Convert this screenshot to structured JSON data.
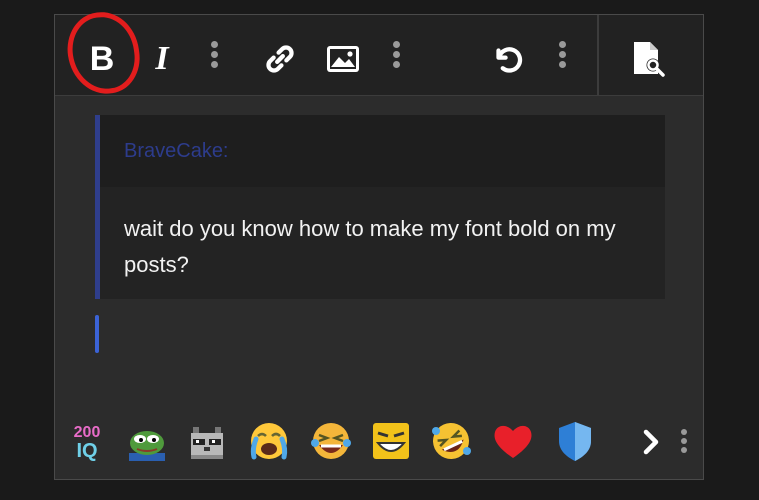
{
  "toolbar": {
    "bold_label": "B",
    "italic_label": "I",
    "buttons": [
      "bold",
      "italic",
      "more-options",
      "link",
      "image",
      "more-options",
      "undo",
      "more-options",
      "preview"
    ]
  },
  "annotation": {
    "color": "#e31d1d",
    "shape": "circle",
    "target": "bold"
  },
  "quote": {
    "author": "BraveCake:",
    "text": "wait do you know how to make my font bold on my posts?"
  },
  "emoji_bar": {
    "items": [
      "200iq-icon",
      "pepe-frog-icon",
      "raccoon-pixel-icon",
      "crying-emoji-icon",
      "laughing-crying-emoji-icon",
      "laughing-square-emoji-icon",
      "rolling-laughing-emoji-icon",
      "red-heart-icon",
      "blue-shield-icon"
    ]
  },
  "colors": {
    "background": "#1a1a1a",
    "editor": "#2c2c2c",
    "toolbar": "#222222",
    "quote_accent": "#2f3e8c",
    "cursor": "#3b63d6"
  }
}
